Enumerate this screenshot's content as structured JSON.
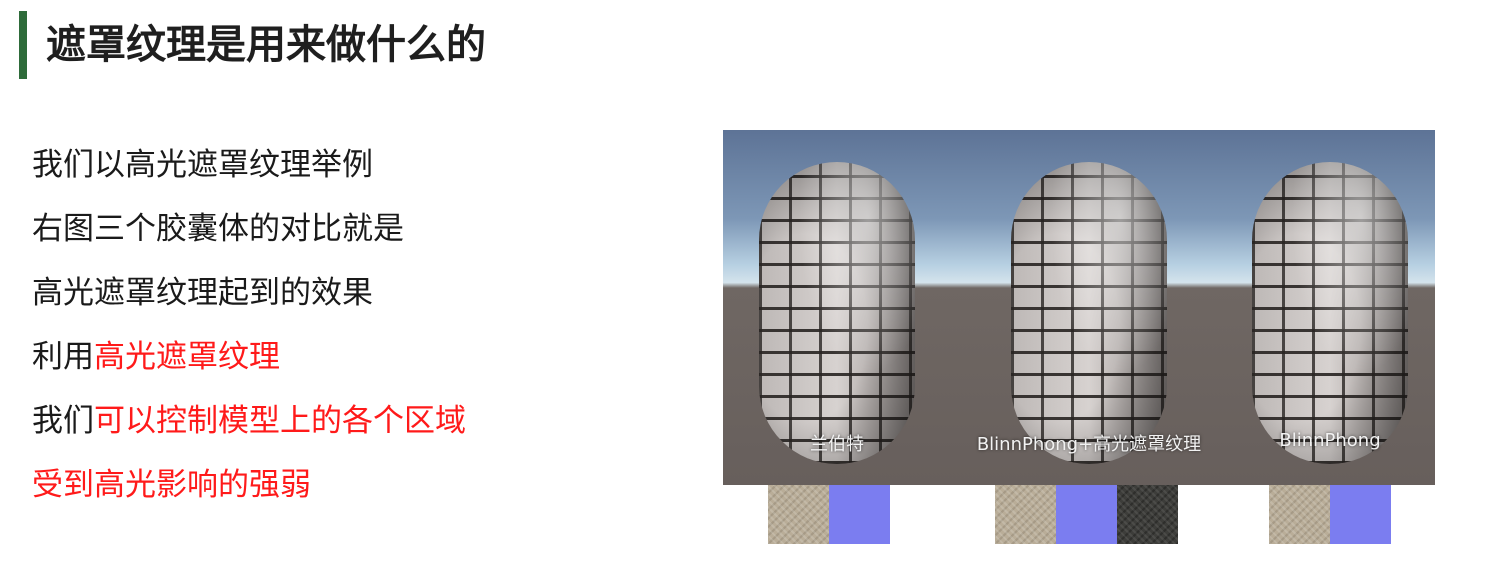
{
  "header": {
    "title": "遮罩纹理是用来做什么的",
    "accent_color": "#2e6b3a"
  },
  "body": {
    "line1": "我们以高光遮罩纹理举例",
    "line2": "右图三个胶囊体的对比就是",
    "line3": "高光遮罩纹理起到的效果",
    "line4_plain": "利用",
    "line4_red": "高光遮罩纹理",
    "line5_plain": "我们",
    "line5_red": "可以控制模型上的各个区域",
    "line6_red": "受到高光影响的强弱",
    "highlight_color": "#ff1a1a"
  },
  "figure": {
    "capsules": [
      {
        "label": "兰伯特"
      },
      {
        "label": "BlinnPhong+高光遮罩纹理"
      },
      {
        "label": "BlinnPhong"
      }
    ],
    "textures": [
      "diffuse-texture",
      "normal-map",
      "specular-mask"
    ]
  }
}
